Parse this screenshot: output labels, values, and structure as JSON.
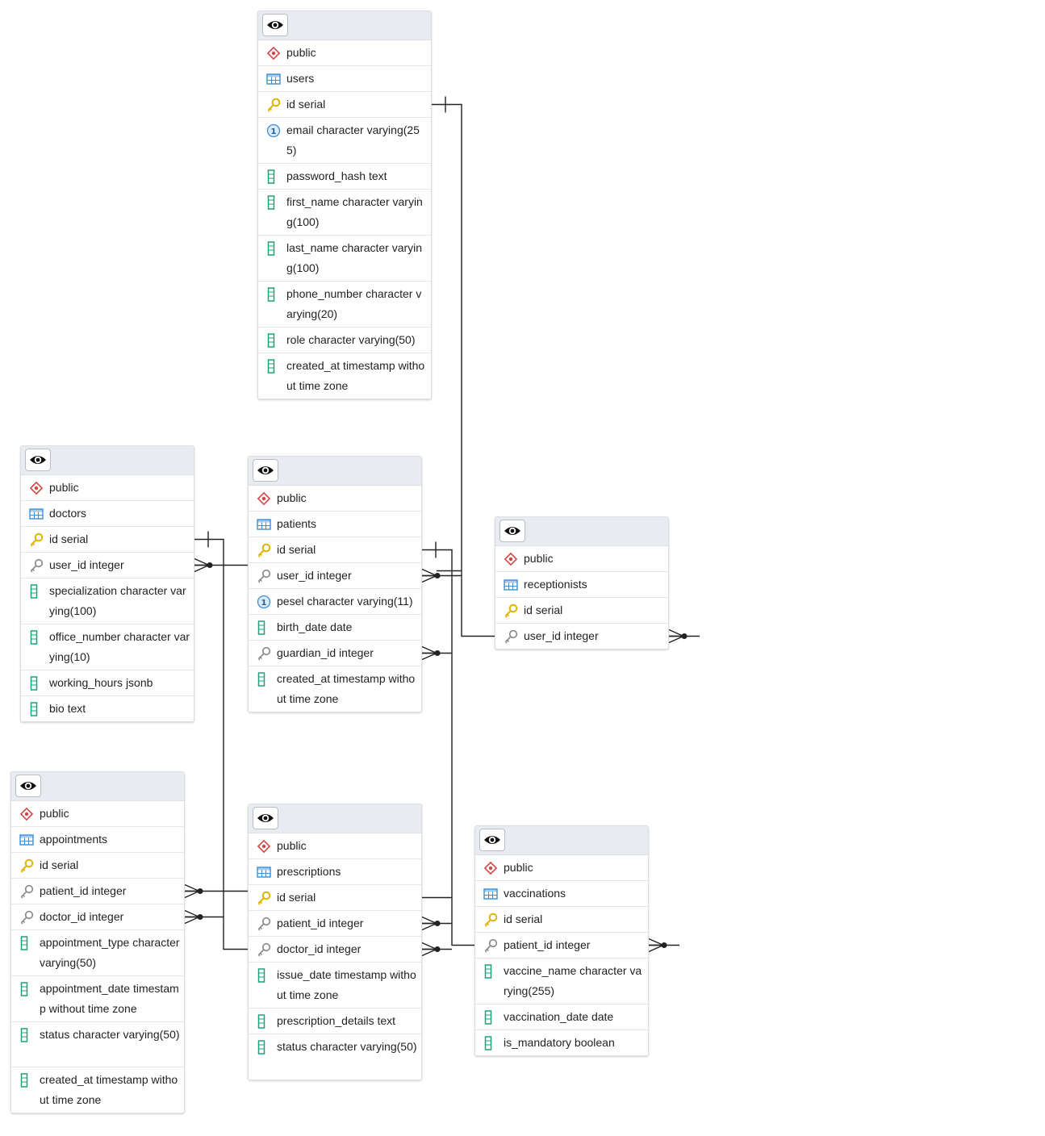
{
  "icons": {
    "eye": "eye-icon",
    "schema": "schema-diamond-icon",
    "table": "table-grid-icon",
    "primary_key": "primary-key-icon",
    "foreign_key": "foreign-key-icon",
    "unique": "unique-constraint-icon",
    "column": "column-icon"
  },
  "colors": {
    "schema": "#d64545",
    "table": "#3b8fd6",
    "primary_key": "#e0b400",
    "foreign_key": "#8a8a8a",
    "unique": "#3b8fd6",
    "column": "#1aa37a",
    "header_bg": "#e8ecf1",
    "line": "#222222"
  },
  "entities": [
    {
      "id": "users",
      "schema": "public",
      "name": "users",
      "rows": [
        {
          "icon": "primary_key",
          "text": "id serial"
        },
        {
          "icon": "unique",
          "text": "email character varying(255)"
        },
        {
          "icon": "column",
          "text": "password_hash text"
        },
        {
          "icon": "column",
          "text": "first_name character varying(100)"
        },
        {
          "icon": "column",
          "text": "last_name character varying(100)"
        },
        {
          "icon": "column",
          "text": "phone_number character varying(20)"
        },
        {
          "icon": "column",
          "text": "role character varying(50)"
        },
        {
          "icon": "column",
          "text": "created_at timestamp without time zone"
        }
      ]
    },
    {
      "id": "doctors",
      "schema": "public",
      "name": "doctors",
      "rows": [
        {
          "icon": "primary_key",
          "text": "id serial"
        },
        {
          "icon": "foreign_key",
          "text": "user_id integer"
        },
        {
          "icon": "column",
          "text": "specialization character varying(100)"
        },
        {
          "icon": "column",
          "text": "office_number character varying(10)"
        },
        {
          "icon": "column",
          "text": "working_hours jsonb"
        },
        {
          "icon": "column",
          "text": "bio text"
        }
      ]
    },
    {
      "id": "patients",
      "schema": "public",
      "name": "patients",
      "rows": [
        {
          "icon": "primary_key",
          "text": "id serial"
        },
        {
          "icon": "foreign_key",
          "text": "user_id integer"
        },
        {
          "icon": "unique",
          "text": "pesel character varying(11)"
        },
        {
          "icon": "column",
          "text": "birth_date date"
        },
        {
          "icon": "foreign_key",
          "text": "guardian_id integer"
        },
        {
          "icon": "column",
          "text": "created_at timestamp without time zone"
        }
      ]
    },
    {
      "id": "receptionists",
      "schema": "public",
      "name": "receptionists",
      "rows": [
        {
          "icon": "primary_key",
          "text": "id serial"
        },
        {
          "icon": "foreign_key",
          "text": "user_id integer"
        }
      ]
    },
    {
      "id": "appointments",
      "schema": "public",
      "name": "appointments",
      "rows": [
        {
          "icon": "primary_key",
          "text": "id serial"
        },
        {
          "icon": "foreign_key",
          "text": "patient_id integer"
        },
        {
          "icon": "foreign_key",
          "text": "doctor_id integer"
        },
        {
          "icon": "column",
          "text": "appointment_type character varying(50)"
        },
        {
          "icon": "column",
          "text": "appointment_date timestamp without time zone"
        },
        {
          "icon": "column",
          "text": "status character varying(50)"
        },
        {
          "icon": "column",
          "text": "created_at timestamp without time zone"
        }
      ]
    },
    {
      "id": "prescriptions",
      "schema": "public",
      "name": "prescriptions",
      "rows": [
        {
          "icon": "primary_key",
          "text": "id serial"
        },
        {
          "icon": "foreign_key",
          "text": "patient_id integer"
        },
        {
          "icon": "foreign_key",
          "text": "doctor_id integer"
        },
        {
          "icon": "column",
          "text": "issue_date timestamp without time zone"
        },
        {
          "icon": "column",
          "text": "prescription_details text"
        },
        {
          "icon": "column",
          "text": "status character varying(50)"
        }
      ]
    },
    {
      "id": "vaccinations",
      "schema": "public",
      "name": "vaccinations",
      "rows": [
        {
          "icon": "primary_key",
          "text": "id serial"
        },
        {
          "icon": "foreign_key",
          "text": "patient_id integer"
        },
        {
          "icon": "column",
          "text": "vaccine_name character varying(255)"
        },
        {
          "icon": "column",
          "text": "vaccination_date date"
        },
        {
          "icon": "column",
          "text": "is_mandatory boolean"
        }
      ]
    }
  ],
  "relationships": [
    {
      "from": "doctors.user_id",
      "to": "users.id"
    },
    {
      "from": "patients.user_id",
      "to": "users.id"
    },
    {
      "from": "receptionists.user_id",
      "to": "users.id"
    },
    {
      "from": "patients.guardian_id",
      "to": "patients.id"
    },
    {
      "from": "appointments.patient_id",
      "to": "patients.id"
    },
    {
      "from": "appointments.doctor_id",
      "to": "doctors.id"
    },
    {
      "from": "prescriptions.patient_id",
      "to": "patients.id"
    },
    {
      "from": "prescriptions.doctor_id",
      "to": "doctors.id"
    },
    {
      "from": "vaccinations.patient_id",
      "to": "patients.id"
    }
  ]
}
